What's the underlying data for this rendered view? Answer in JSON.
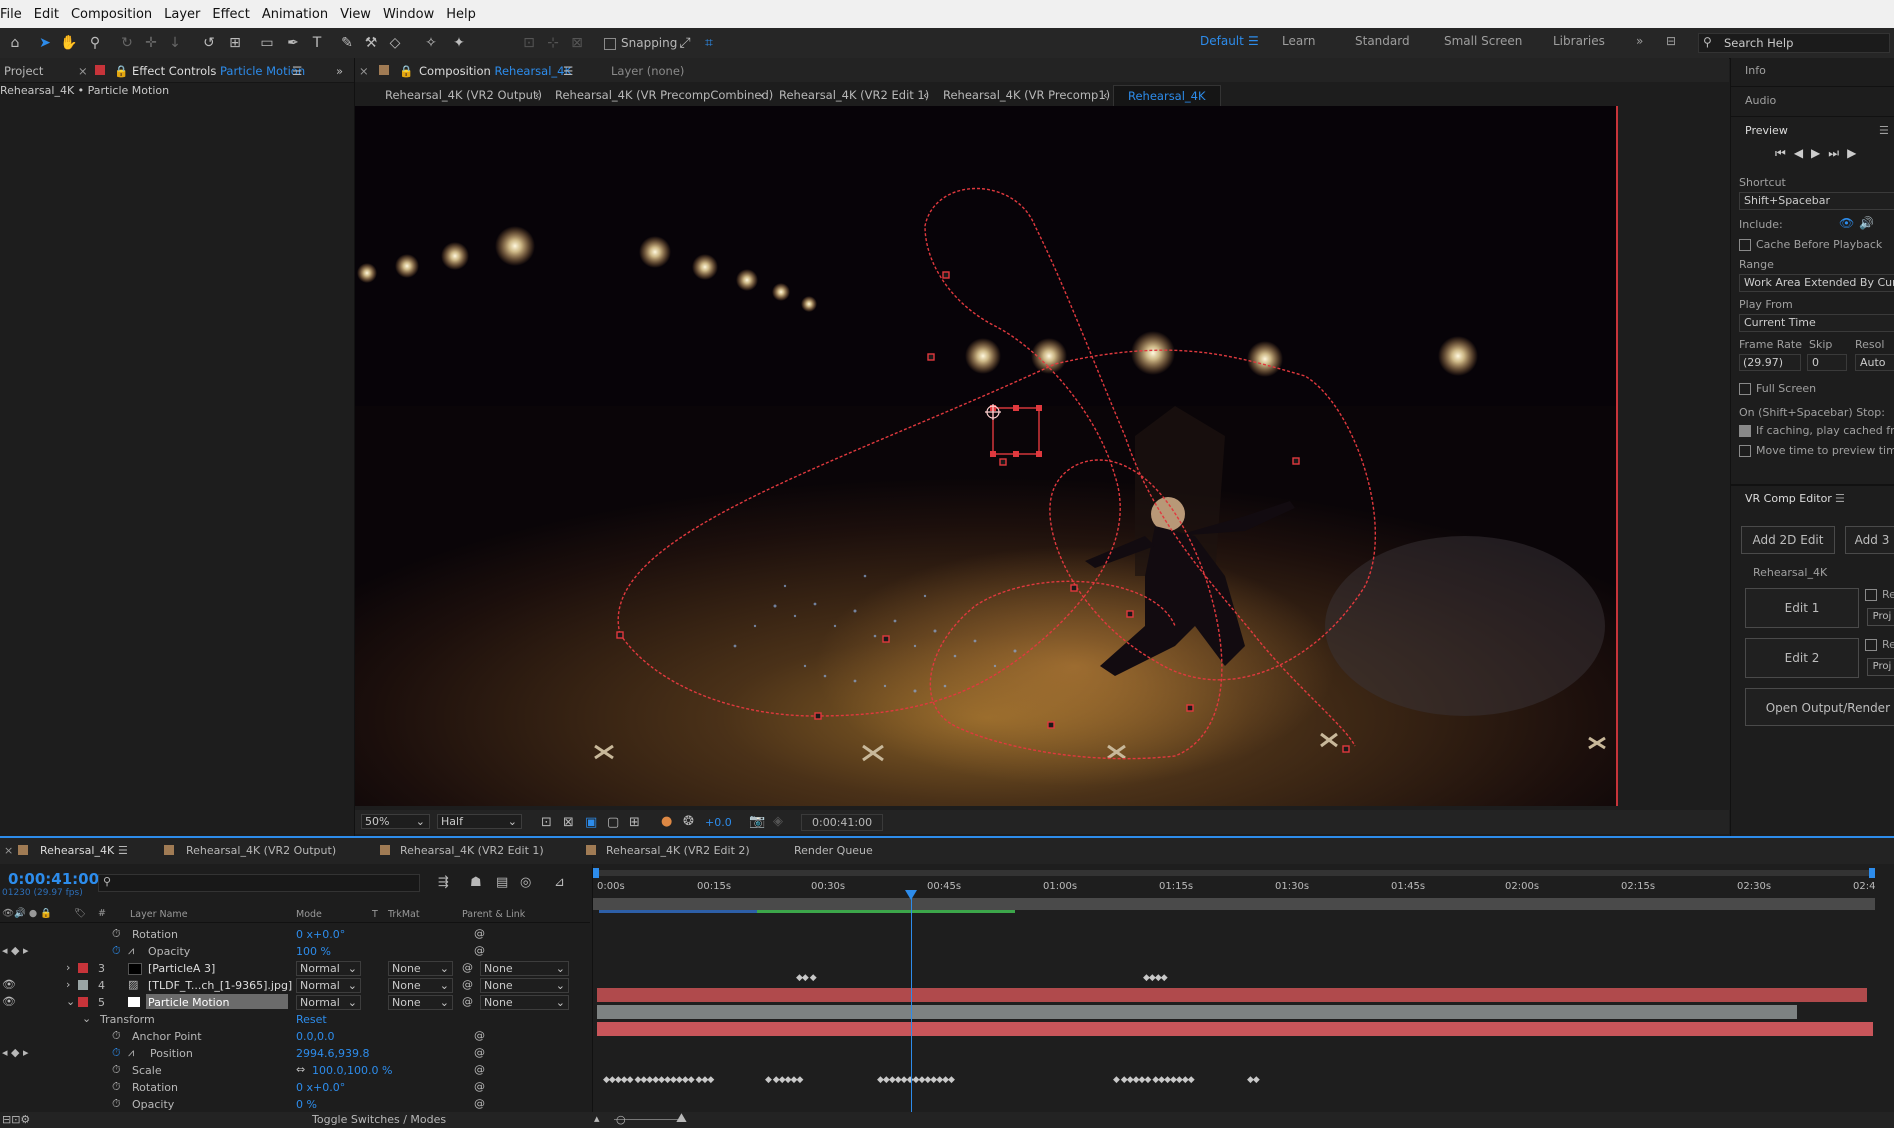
{
  "menu": [
    "File",
    "Edit",
    "Composition",
    "Layer",
    "Effect",
    "Animation",
    "View",
    "Window",
    "Help"
  ],
  "toolbar": {
    "snapping": "Snapping",
    "search_placeholder": "Search Help"
  },
  "workspaces": {
    "active": "Default",
    "items": [
      "Learn",
      "Standard",
      "Small Screen",
      "Libraries"
    ]
  },
  "left_panel": {
    "tab_project": "Project",
    "tab_effect_prefix": "Effect Controls",
    "tab_effect_name": "Particle Motion",
    "subtitle": "Rehearsal_4K • Particle Motion"
  },
  "comp_panel": {
    "tab_prefix": "Composition",
    "tab_name": "Rehearsal_4K",
    "layer_tab": "Layer  (none)",
    "breadcrumbs": [
      "Rehearsal_4K (VR2 Output)",
      "Rehearsal_4K (VR PrecompCombined)",
      "Rehearsal_4K (VR2 Edit 1)",
      "Rehearsal_4K (VR Precomp1)",
      "Rehearsal_4K"
    ],
    "zoom": "50%",
    "resolution": "Half",
    "exposure": "+0.0",
    "timecode": "0:00:41:00"
  },
  "right_panel": {
    "info": "Info",
    "audio": "Audio",
    "preview": "Preview",
    "shortcut_label": "Shortcut",
    "shortcut_value": "Shift+Spacebar",
    "include_label": "Include:",
    "cache_before": "Cache Before Playback",
    "range_label": "Range",
    "range_value": "Work Area Extended By Cur",
    "play_from_label": "Play From",
    "play_from_value": "Current Time",
    "frame_rate_label": "Frame Rate",
    "skip_label": "Skip",
    "res_label": "Resol",
    "frame_rate_value": "(29.97)",
    "skip_value": "0",
    "res_value": "Auto",
    "full_screen": "Full Screen",
    "stop_label": "On (Shift+Spacebar) Stop:",
    "if_caching": "If caching, play cached fra",
    "move_time": "Move time to preview tim",
    "vr_title": "VR Comp Editor",
    "add_2d": "Add 2D Edit",
    "add_3": "Add 3",
    "vr_comp": "Rehearsal_4K",
    "edit1": "Edit 1",
    "edit2": "Edit 2",
    "re": "Re",
    "proj": "Proj",
    "open_output": "Open Output/Render"
  },
  "timeline": {
    "tabs": [
      "Rehearsal_4K",
      "Rehearsal_4K (VR2 Output)",
      "Rehearsal_4K (VR2 Edit 1)",
      "Rehearsal_4K (VR2 Edit 2)",
      "Render Queue"
    ],
    "current_time": "0:00:41:00",
    "frames": "01230 (29.97 fps)",
    "columns": {
      "layer_name": "Layer Name",
      "mode": "Mode",
      "t": "T",
      "trkmat": "TrkMat",
      "parent": "Parent & Link"
    },
    "ruler": [
      "0:00s",
      "00:15s",
      "00:30s",
      "00:45s",
      "01:00s",
      "01:15s",
      "01:30s",
      "01:45s",
      "02:00s",
      "02:15s",
      "02:30s",
      "02:4"
    ],
    "rows": [
      {
        "label": "Rotation",
        "value": "0 x+0.0°"
      },
      {
        "label": "Opacity",
        "value": "100 %"
      },
      {
        "num": "3",
        "name": "[ParticleA 3]",
        "mode": "Normal",
        "trk": "None",
        "parent": "None"
      },
      {
        "num": "4",
        "name": "[TLDF_T...ch_[1-9365].jpg]",
        "mode": "Normal",
        "trk": "None",
        "parent": "None"
      },
      {
        "num": "5",
        "name": "Particle Motion",
        "mode": "Normal",
        "trk": "None",
        "parent": "None"
      },
      {
        "label": "Transform",
        "value": "Reset"
      },
      {
        "label": "Anchor Point",
        "value": "0.0,0.0"
      },
      {
        "label": "Position",
        "value": "2994.6,939.8"
      },
      {
        "label": "Scale",
        "value": "100.0,100.0 %"
      },
      {
        "label": "Rotation",
        "value": "0 x+0.0°"
      },
      {
        "label": "Opacity",
        "value": "0 %"
      }
    ],
    "footer": "Toggle Switches / Modes"
  }
}
